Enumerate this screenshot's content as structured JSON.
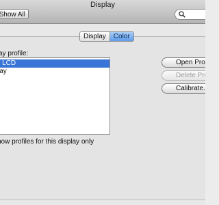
{
  "window": {
    "title": "Display"
  },
  "toolbar": {
    "show_all_label": "Show All",
    "search_placeholder": ""
  },
  "tabs": [
    {
      "label": "Display",
      "selected": false
    },
    {
      "label": "Color",
      "selected": true
    }
  ],
  "color_panel": {
    "profile_label": "ay profile:",
    "profiles": [
      {
        "label": "r LCD",
        "selected": true
      },
      {
        "label": "lay",
        "selected": false
      }
    ],
    "buttons": {
      "open_profile": "Open Profile",
      "delete_profile": "Delete Profile",
      "calibrate": "Calibrate..."
    },
    "show_profiles_checkbox": "how profiles for this display only"
  },
  "colors": {
    "selection": "#3875d7",
    "tab_selected": "#6ba5ef"
  },
  "icons": [
    "search-icon"
  ]
}
